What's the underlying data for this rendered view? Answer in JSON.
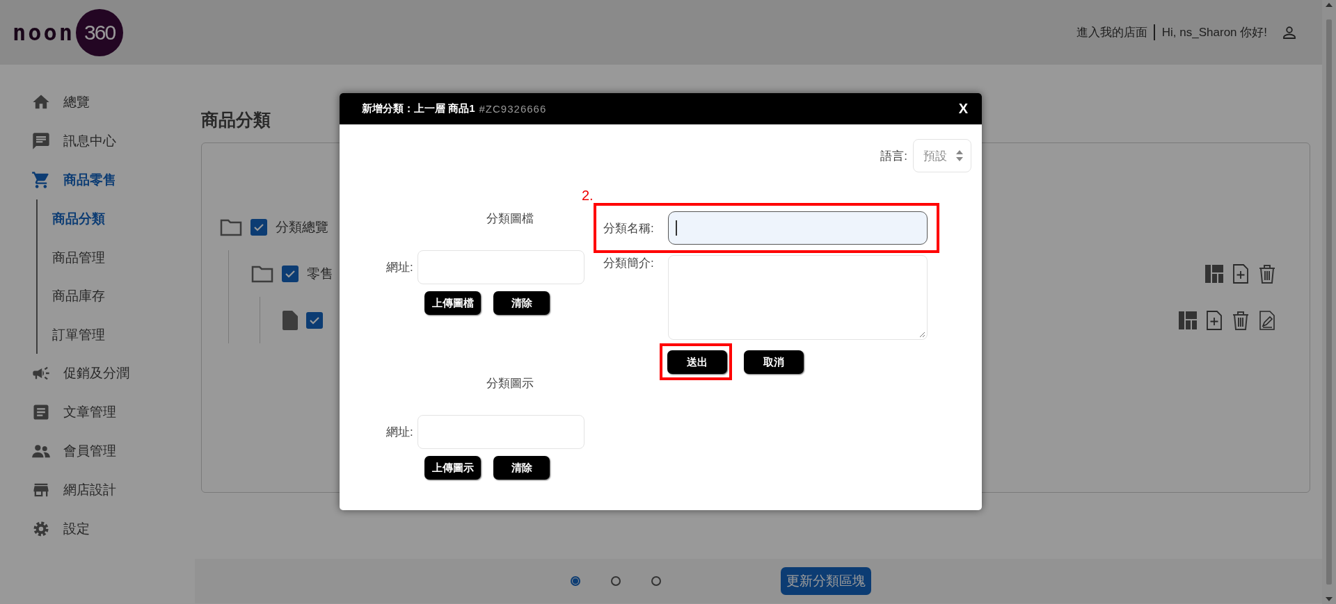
{
  "header": {
    "logo_word": "noon",
    "logo_badge": "360",
    "store_link": "進入我的店面",
    "greeting": "Hi, ns_Sharon 你好!"
  },
  "sidebar": {
    "items": [
      {
        "label": "總覽",
        "selected": false
      },
      {
        "label": "訊息中心",
        "selected": false
      },
      {
        "label": "商品零售",
        "selected": true,
        "children": [
          {
            "label": "商品分類",
            "selected": true
          },
          {
            "label": "商品管理",
            "selected": false
          },
          {
            "label": "商品庫存",
            "selected": false
          },
          {
            "label": "訂單管理",
            "selected": false
          }
        ]
      },
      {
        "label": "促銷及分潤",
        "selected": false
      },
      {
        "label": "文章管理",
        "selected": false
      },
      {
        "label": "會員管理",
        "selected": false
      },
      {
        "label": "網店設計",
        "selected": false
      },
      {
        "label": "設定",
        "selected": false
      }
    ]
  },
  "page": {
    "title": "商品分類",
    "tree": [
      {
        "kind": "folder",
        "label": "分類總覽",
        "checked": true,
        "children": [
          {
            "kind": "folder",
            "label": "零售",
            "checked": true,
            "children": [
              {
                "kind": "file",
                "checked": true
              }
            ]
          }
        ]
      }
    ],
    "pagination": [
      {
        "selected": true
      },
      {
        "selected": false
      },
      {
        "selected": false
      }
    ],
    "update_button": "更新分類區塊"
  },
  "dialog": {
    "title": "新增分類：上一層 商品1",
    "code": "#ZC9326666",
    "close": "X",
    "language": {
      "label": "語言:",
      "value": "預設"
    },
    "annotation": "2.",
    "image_sections": [
      {
        "heading": "分類圖檔",
        "url_label": "網址:",
        "buttons": [
          "上傳圖檔",
          "清除"
        ]
      },
      {
        "heading": "分類圖示",
        "url_label": "網址:",
        "buttons": [
          "上傳圖示",
          "清除"
        ]
      }
    ],
    "name_field": {
      "label": "分類名稱:",
      "focused": true,
      "highlighted": true
    },
    "description_field": {
      "label": "分類簡介:"
    },
    "buttons": [
      {
        "label": "送出",
        "highlighted": true
      },
      {
        "label": "取消",
        "highlighted": false
      }
    ]
  }
}
